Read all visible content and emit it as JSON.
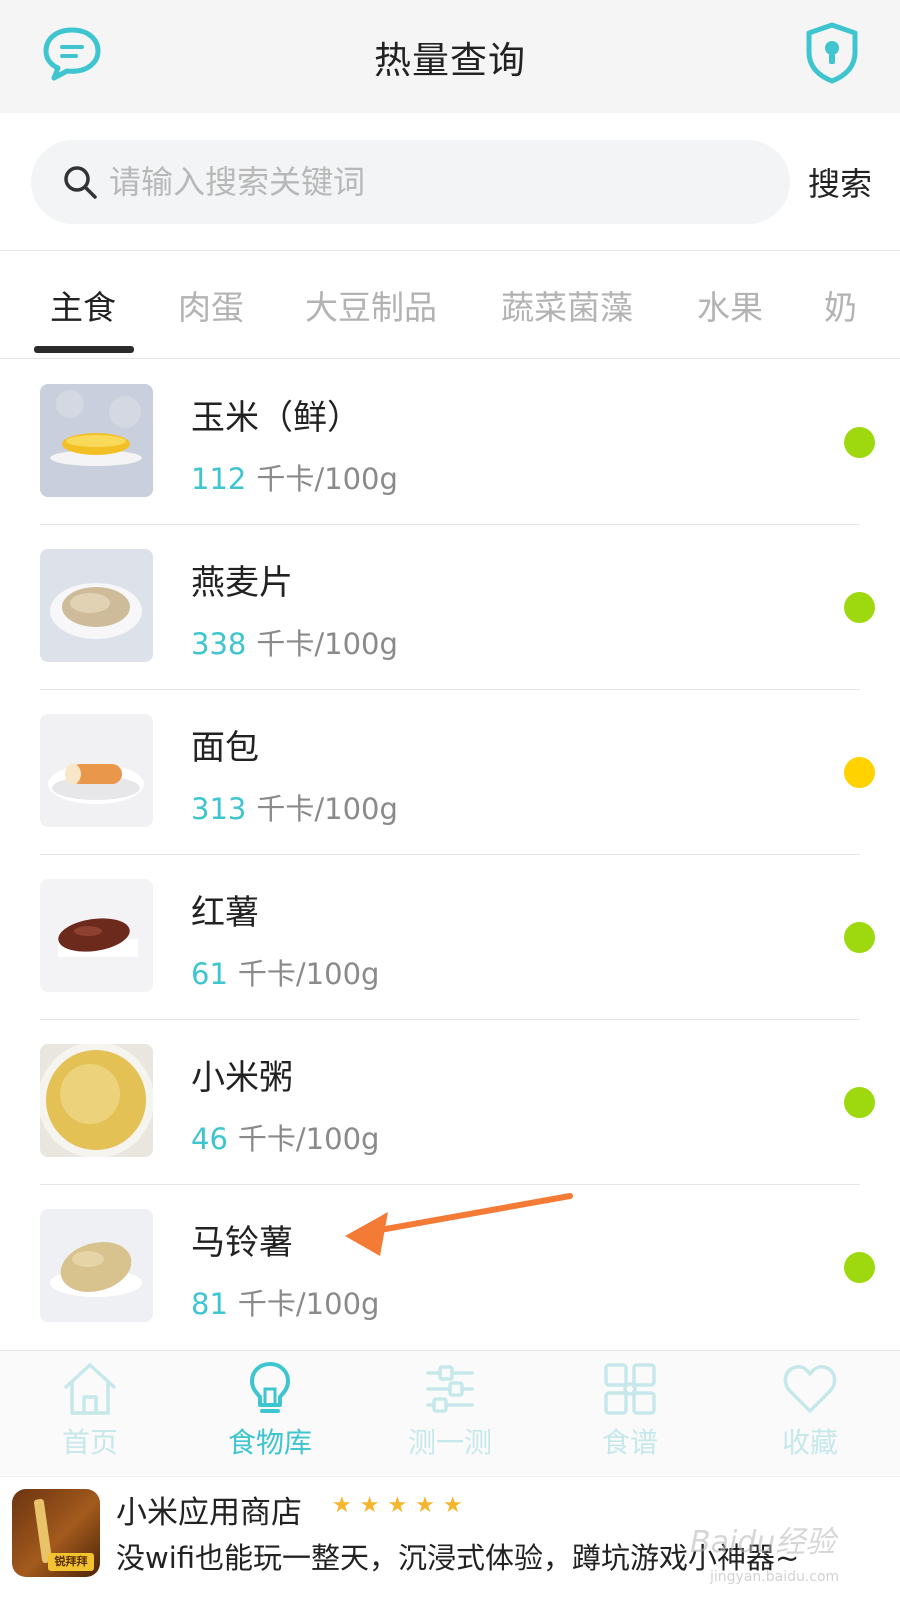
{
  "header": {
    "title": "热量查询",
    "left_icon": "chat-bubble-icon",
    "right_icon": "shield-lock-icon"
  },
  "search": {
    "placeholder": "请输入搜索关键词",
    "button_label": "搜索"
  },
  "tabs": [
    {
      "label": "主食",
      "active": true
    },
    {
      "label": "肉蛋",
      "active": false
    },
    {
      "label": "大豆制品",
      "active": false
    },
    {
      "label": "蔬菜菌藻",
      "active": false
    },
    {
      "label": "水果",
      "active": false
    },
    {
      "label": "奶",
      "active": false
    }
  ],
  "foods": [
    {
      "name": "玉米（鲜）",
      "calories": "112",
      "unit": "千卡/100g",
      "level_color": "#9ed90f"
    },
    {
      "name": "燕麦片",
      "calories": "338",
      "unit": "千卡/100g",
      "level_color": "#9ed90f"
    },
    {
      "name": "面包",
      "calories": "313",
      "unit": "千卡/100g",
      "level_color": "#ffd200"
    },
    {
      "name": "红薯",
      "calories": "61",
      "unit": "千卡/100g",
      "level_color": "#9ed90f"
    },
    {
      "name": "小米粥",
      "calories": "46",
      "unit": "千卡/100g",
      "level_color": "#9ed90f"
    },
    {
      "name": "马铃薯",
      "calories": "81",
      "unit": "千卡/100g",
      "level_color": "#9ed90f"
    }
  ],
  "tabbar": [
    {
      "label": "首页",
      "icon": "home-icon",
      "active": false
    },
    {
      "label": "食物库",
      "icon": "lightbulb-icon",
      "active": true
    },
    {
      "label": "测一测",
      "icon": "sliders-icon",
      "active": false
    },
    {
      "label": "食谱",
      "icon": "grid-icon",
      "active": false
    },
    {
      "label": "收藏",
      "icon": "heart-icon",
      "active": false
    }
  ],
  "ad": {
    "app_name": "小米应用商店",
    "stars": "★★★★★",
    "description": "没wifi也能玩一整天，沉浸式体验，蹲坑游戏小神器~",
    "icon_badge": "锐拜拜",
    "watermark": "Baidu经验",
    "watermark_sub": "jingyan.baidu.com"
  },
  "colors": {
    "accent": "#3ec5cf",
    "green_dot": "#9ed90f",
    "yellow_dot": "#ffd200",
    "arrow": "#f47b35"
  }
}
